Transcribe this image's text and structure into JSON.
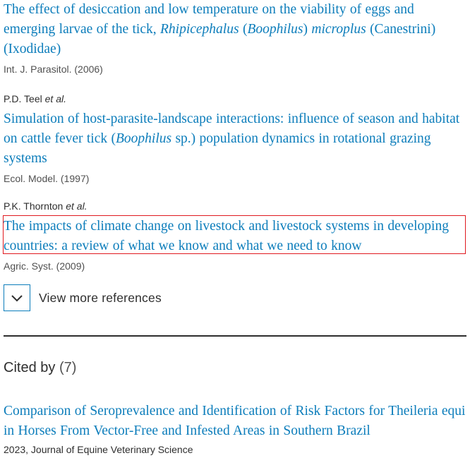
{
  "references": [
    {
      "author": "",
      "title_parts": [
        {
          "text": "The effect of desiccation and low temperature on the viability of eggs and emerging larvae of the tick, ",
          "italic": false
        },
        {
          "text": "Rhipicephalus",
          "italic": true
        },
        {
          "text": " (",
          "italic": false
        },
        {
          "text": "Boophilus",
          "italic": true
        },
        {
          "text": ") ",
          "italic": false
        },
        {
          "text": "microplus",
          "italic": true
        },
        {
          "text": " (Canestrini) (Ixodidae)",
          "italic": false
        }
      ],
      "source": "Int. J. Parasitol. (2006)"
    },
    {
      "author": "P.D. Teel",
      "author_suffix": "et al.",
      "title_parts": [
        {
          "text": "Simulation of host-parasite-landscape interactions: influence of season and habitat on cattle fever tick (",
          "italic": false
        },
        {
          "text": "Boophilus",
          "italic": true
        },
        {
          "text": " sp.) population dynamics in rotational grazing systems",
          "italic": false
        }
      ],
      "source": "Ecol. Model. (1997)"
    },
    {
      "author": "P.K. Thornton",
      "author_suffix": "et al.",
      "title_parts": [
        {
          "text": "The impacts of climate change on livestock and livestock systems in developing countries: a review of what we know and what we need to know",
          "italic": false
        }
      ],
      "source": "Agric. Syst. (2009)"
    }
  ],
  "view_more": {
    "label": "View more references",
    "icon": "chevron-down-icon"
  },
  "cited_by": {
    "label": "Cited by",
    "count": "(7)",
    "items": [
      {
        "title": "Comparison of Seroprevalence and Identification of Risk Factors for Theileria equi in Horses From Vector-Free and Infested Areas in Southern Brazil",
        "meta": "2023, Journal of Equine Veterinary Science"
      }
    ]
  },
  "colors": {
    "link": "#0c7dbb",
    "text": "#2e2e2e",
    "highlight_border": "#e0191f"
  }
}
